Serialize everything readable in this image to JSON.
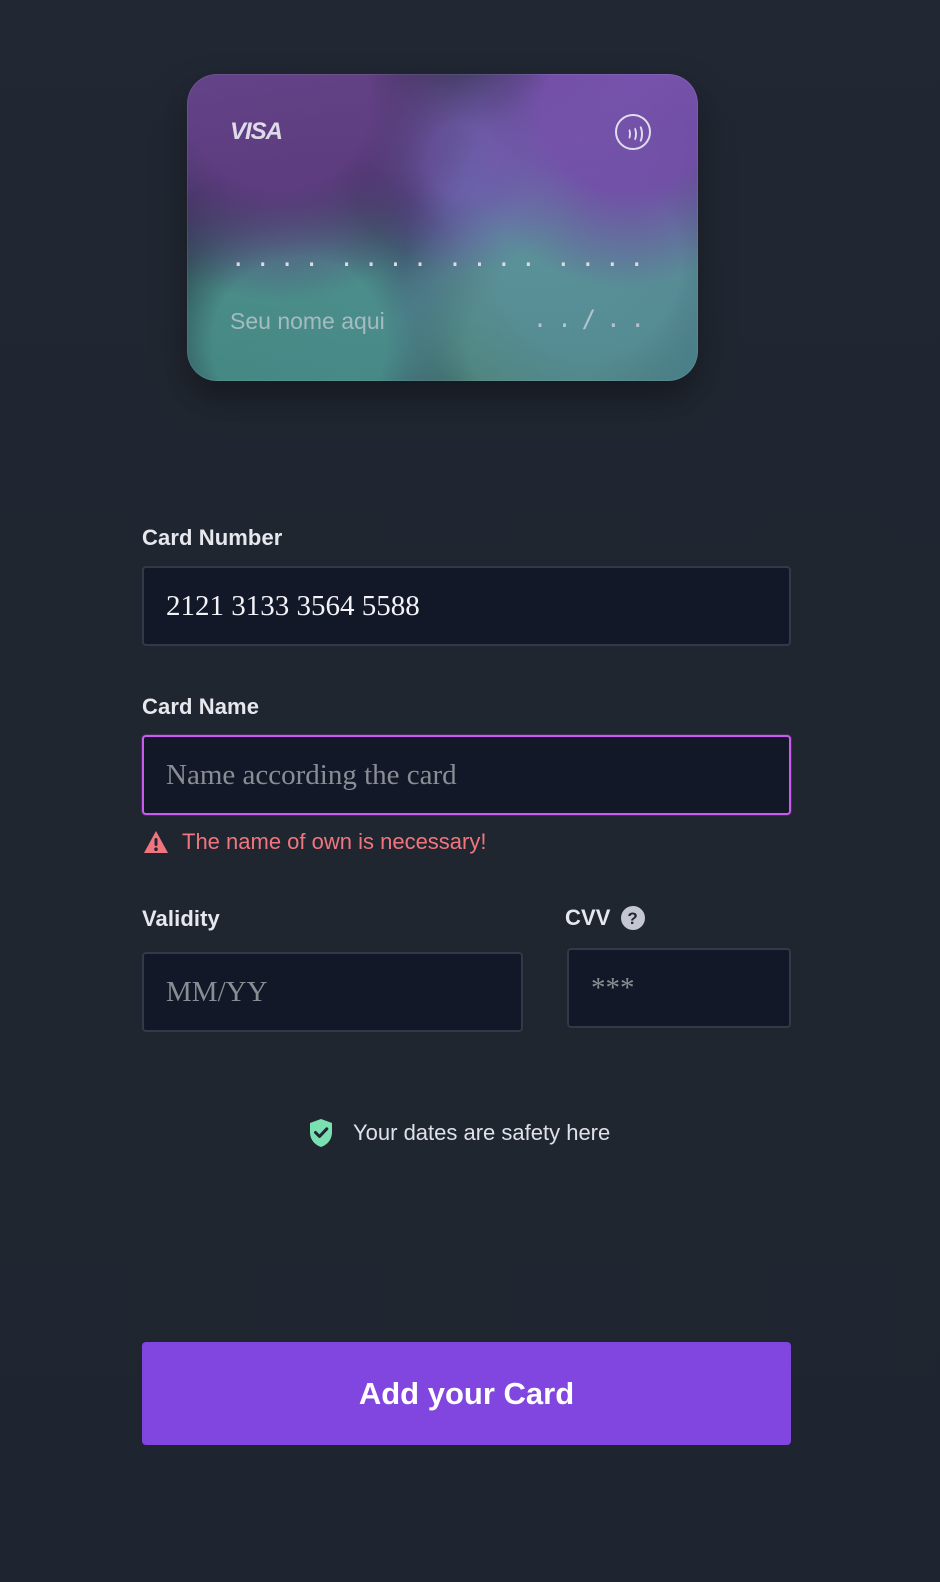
{
  "card_preview": {
    "brand": "VISA",
    "number_groups": [
      "....",
      "....",
      "....",
      "...."
    ],
    "holder_placeholder": "Seu nome aqui",
    "expiry_placeholder": "../.."
  },
  "form": {
    "card_number": {
      "label": "Card Number",
      "value": "2121 3133 3564 5588"
    },
    "card_name": {
      "label": "Card Name",
      "placeholder": "Name according the card",
      "error": "The name of own is necessary!"
    },
    "validity": {
      "label": "Validity",
      "placeholder": "MM/YY"
    },
    "cvv": {
      "label": "CVV",
      "help": "?",
      "placeholder": "***"
    },
    "safety_text": "Your dates are safety here",
    "submit_label": "Add your Card"
  },
  "colors": {
    "background": "#202634",
    "field_bg": "#121827",
    "field_border": "#323948",
    "active_border": "#cc59f1",
    "error": "#f0757e",
    "accent": "#8146df",
    "shield": "#7be0b1"
  },
  "icons": {
    "contactless": "contactless-icon",
    "warning": "warning-icon",
    "help": "help-icon",
    "shield": "shield-check-icon"
  }
}
